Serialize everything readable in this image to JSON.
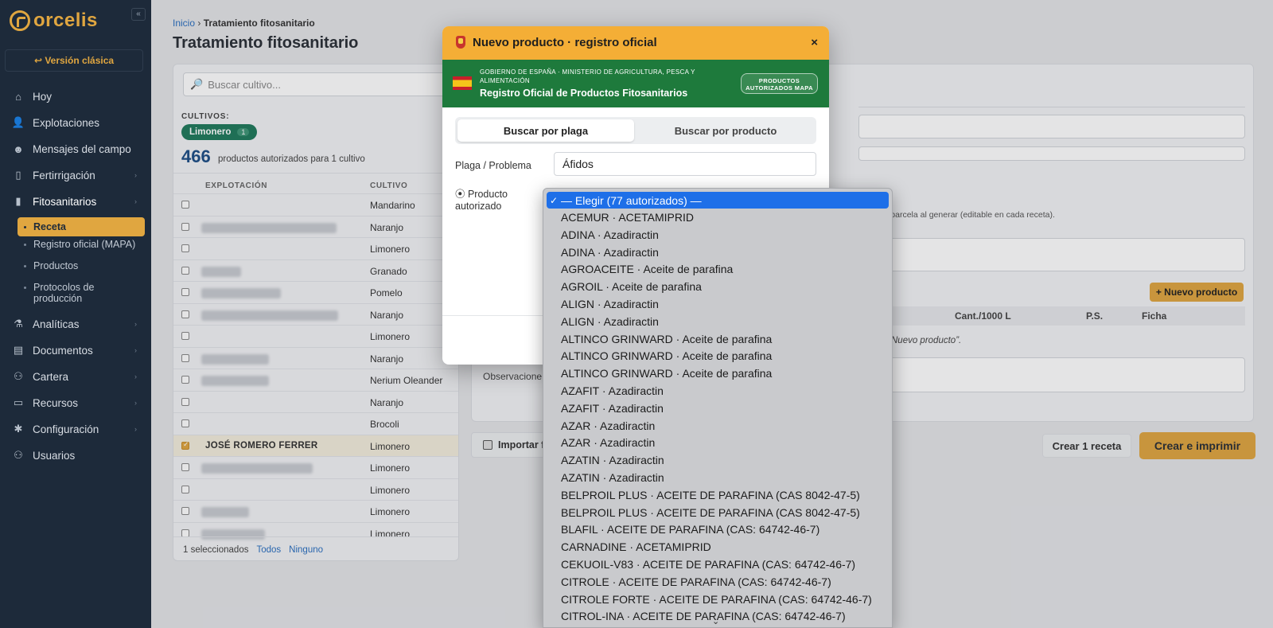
{
  "sidebar": {
    "logo_text": "orcelis",
    "collapse_label": "«",
    "classic_label": "↩ Versión clásica",
    "items": [
      {
        "label": "Hoy",
        "icon": "home-icon",
        "glyph": "⌂",
        "chevron": ""
      },
      {
        "label": "Explotaciones",
        "icon": "user-icon",
        "glyph": "👤",
        "chevron": ""
      },
      {
        "label": "Mensajes del campo",
        "icon": "farmer-icon",
        "glyph": "☻",
        "chevron": ""
      },
      {
        "label": "Fertirrigación",
        "icon": "bottle-icon",
        "glyph": "▯",
        "chevron": "›"
      },
      {
        "label": "Fitosanitarios",
        "icon": "spray-icon",
        "glyph": "▮",
        "chevron": "›"
      },
      {
        "label": "Analíticas",
        "icon": "flask-icon",
        "glyph": "⚗",
        "chevron": "›"
      },
      {
        "label": "Documentos",
        "icon": "document-icon",
        "glyph": "▤",
        "chevron": "›"
      },
      {
        "label": "Cartera",
        "icon": "people-icon",
        "glyph": "⚇",
        "chevron": "›"
      },
      {
        "label": "Recursos",
        "icon": "folder-icon",
        "glyph": "▭",
        "chevron": "›"
      },
      {
        "label": "Configuración",
        "icon": "gear-icon",
        "glyph": "✱",
        "chevron": "›"
      },
      {
        "label": "Usuarios",
        "icon": "users-icon",
        "glyph": "⚇",
        "chevron": ""
      }
    ],
    "sub_items": [
      {
        "label": "Receta",
        "active": true
      },
      {
        "label": "Registro oficial (MAPA)",
        "active": false
      },
      {
        "label": "Productos",
        "active": false
      },
      {
        "label": "Protocolos de producción",
        "active": false
      }
    ]
  },
  "breadcrumb": {
    "home": "Inicio",
    "sep": "›",
    "current": "Tratamiento fitosanitario"
  },
  "page_title": "Tratamiento fitosanitario",
  "left": {
    "search_placeholder": "Buscar cultivo...",
    "cultivos_label": "CULTIVOS:",
    "chip": {
      "label": "Limonero",
      "count": "1"
    },
    "count_num": "466",
    "count_text": "productos autorizados para 1 cultivo",
    "col_explotacion": "EXPLOTACIÓN",
    "col_cultivo": "CULTIVO",
    "rows": [
      {
        "name": "",
        "blur_w": 0,
        "crop": "Mandarino",
        "checked": false
      },
      {
        "name": "",
        "blur_w": 170,
        "crop": "Naranjo",
        "checked": false
      },
      {
        "name": "",
        "blur_w": 0,
        "crop": "Limonero",
        "checked": false
      },
      {
        "name": "",
        "blur_w": 50,
        "crop": "Granado",
        "checked": false
      },
      {
        "name": "",
        "blur_w": 100,
        "crop": "Pomelo",
        "checked": false
      },
      {
        "name": "",
        "blur_w": 172,
        "crop": "Naranjo",
        "checked": false
      },
      {
        "name": "",
        "blur_w": 0,
        "crop": "Limonero",
        "checked": false
      },
      {
        "name": "",
        "blur_w": 85,
        "crop": "Naranjo",
        "checked": false
      },
      {
        "name": "",
        "blur_w": 85,
        "crop": "Nerium Oleander",
        "checked": false
      },
      {
        "name": "",
        "blur_w": 0,
        "crop": "Naranjo",
        "checked": false
      },
      {
        "name": "",
        "blur_w": 0,
        "crop": "Brocoli",
        "checked": false
      },
      {
        "name": "JOSÉ ROMERO FERRER",
        "blur_w": 0,
        "crop": "Limonero",
        "checked": true
      },
      {
        "name": "",
        "blur_w": 140,
        "crop": "Limonero",
        "checked": false
      },
      {
        "name": "",
        "blur_w": 0,
        "crop": "Limonero",
        "checked": false
      },
      {
        "name": "",
        "blur_w": 60,
        "crop": "Limonero",
        "checked": false
      },
      {
        "name": "",
        "blur_w": 80,
        "crop": "Limonero",
        "checked": false
      }
    ],
    "footer_selected": "1 seleccionados",
    "footer_all": "Todos",
    "footer_none": "Ninguno"
  },
  "right": {
    "hint": "cula por parcela al generar (editable en cada receta).",
    "new_product": "+ Nuevo producto",
    "col_s": "s",
    "col_cant": "Cant./1000 L",
    "col_ps": "P.S.",
    "col_ficha": "Ficha",
    "empty_note": "Nuevo producto”.",
    "obs_label": "Observacione"
  },
  "bottom": {
    "import": "Importar f",
    "create_one": "Crear 1 receta",
    "create_print": "Crear e imprimir"
  },
  "modal": {
    "title": "Nuevo producto · registro oficial",
    "close": "×",
    "gov_line": "GOBIERNO DE ESPAÑA · MINISTERIO DE AGRICULTURA, PESCA Y ALIMENTACIÓN",
    "gov_title": "Registro Oficial de Productos Fitosanitarios",
    "gov_badge": "PRODUCTOS AUTORIZADOS MAPA",
    "tab_plaga": "Buscar por plaga",
    "tab_producto": "Buscar por producto",
    "plaga_label": "Plaga / Problema",
    "plaga_value": "Áfidos",
    "producto_label": "⦿ Producto autorizado"
  },
  "dropdown": {
    "selected": "— Elegir (77 autorizados) —",
    "check": "✓",
    "options": [
      "ACEMUR · ACETAMIPRID",
      "ADINA · Azadiractin",
      "ADINA · Azadiractin",
      "AGROACEITE · Aceite de parafina",
      "AGROIL · Aceite de parafina",
      "ALIGN · Azadiractin",
      "ALIGN · Azadiractin",
      "ALTINCO GRINWARD · Aceite de parafina",
      "ALTINCO GRINWARD · Aceite de parafina",
      "ALTINCO GRINWARD · Aceite de parafina",
      "AZAFIT · Azadiractin",
      "AZAFIT · Azadiractin",
      "AZAR · Azadiractin",
      "AZAR · Azadiractin",
      "AZATIN · Azadiractin",
      "AZATIN · Azadiractin",
      "BELPROIL PLUS · ACEITE DE PARAFINA (CAS 8042-47-5)",
      "BELPROIL PLUS · ACEITE DE PARAFINA (CAS 8042-47-5)",
      "BLAFIL · ACEITE DE PARAFINA (CAS: 64742-46-7)",
      "CARNADINE · ACETAMIPRID",
      "CEKUOIL-V83 · ACEITE DE PARAFINA (CAS: 64742-46-7)",
      "CITROLE · ACEITE DE PARAFINA (CAS: 64742-46-7)",
      "CITROLE FORTE · ACEITE DE PARAFINA (CAS: 64742-46-7)",
      "CITROL-INA · ACEITE DE PARAFINA (CAS: 64742-46-7)"
    ],
    "more": "⌄"
  }
}
